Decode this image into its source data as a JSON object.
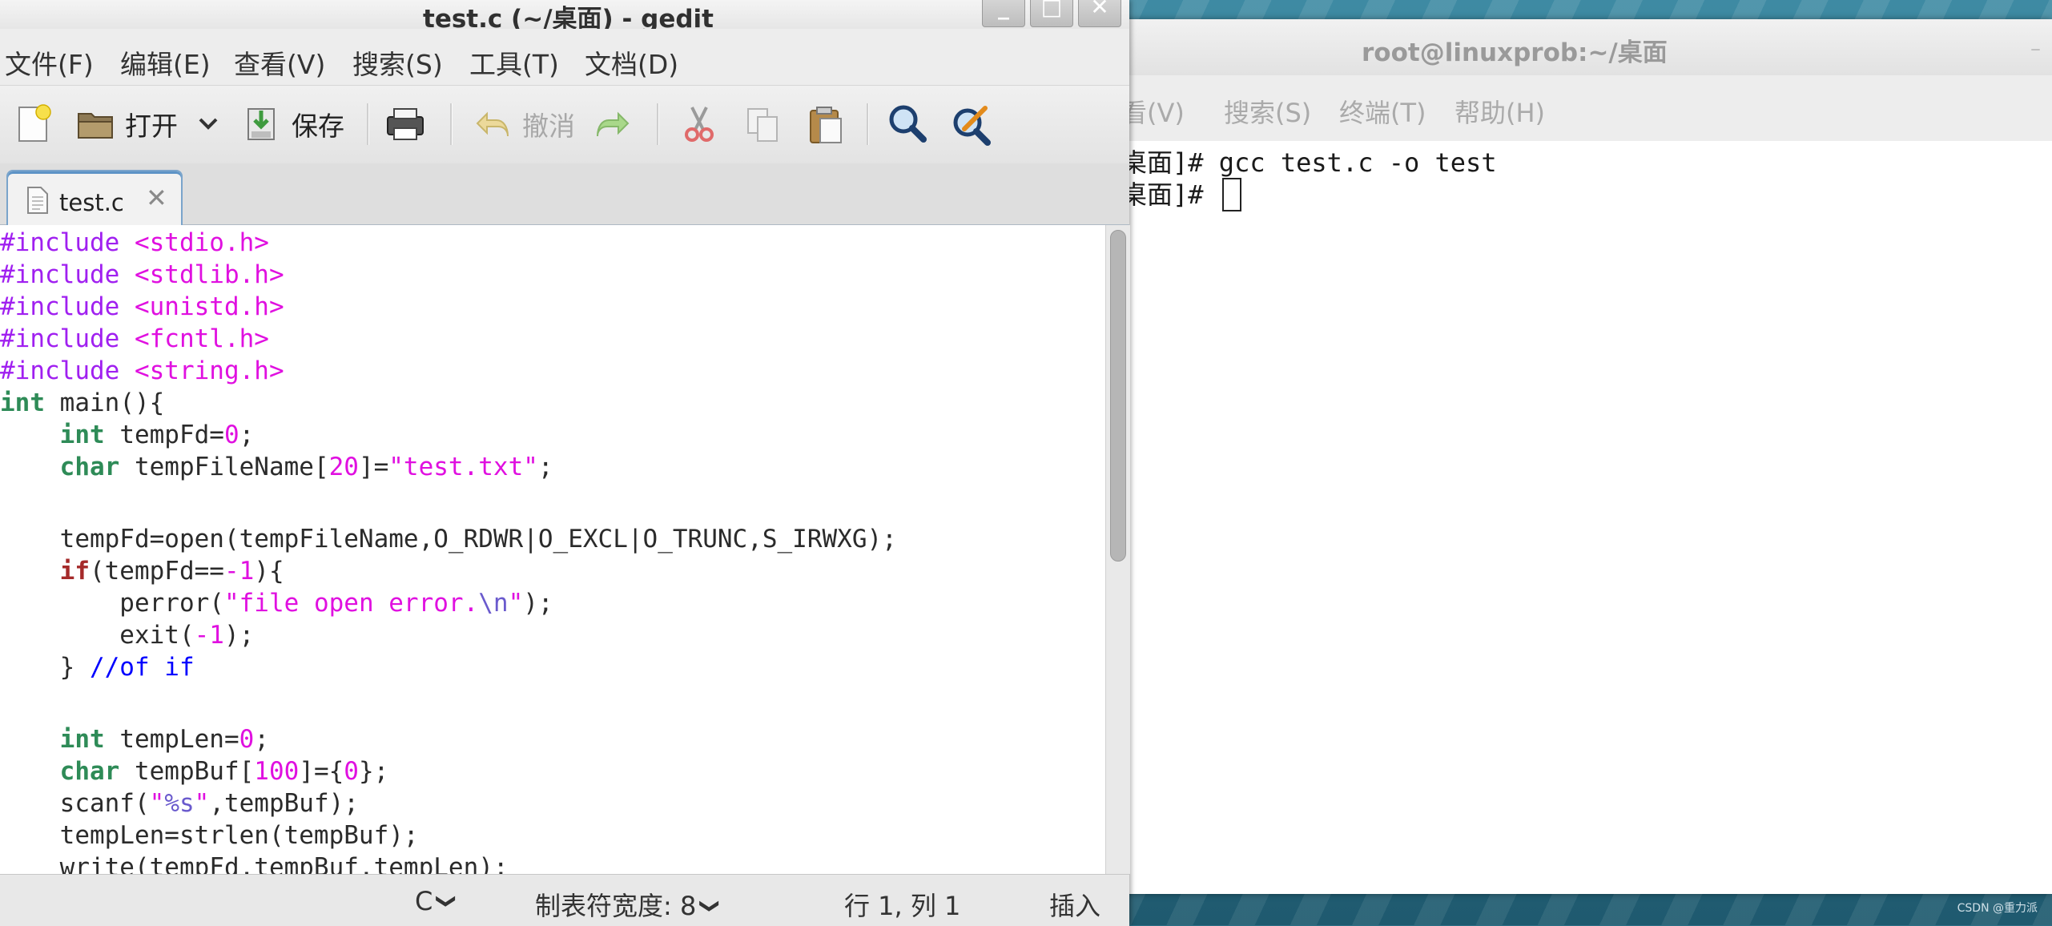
{
  "gedit": {
    "title": "test.c (~/桌面) - gedit",
    "window_buttons": {
      "minimize": "_",
      "maximize": "□",
      "close": "✕"
    },
    "menu": [
      "文件(F)",
      "编辑(E)",
      "查看(V)",
      "搜索(S)",
      "工具(T)",
      "文档(D)"
    ],
    "toolbar": {
      "open_label": "打开",
      "save_label": "保存",
      "undo_label": "撤消"
    },
    "tab": {
      "label": "test.c",
      "close": "✕"
    },
    "code": [
      "#include <stdio.h>",
      "#include <stdlib.h>",
      "#include <unistd.h>",
      "#include <fcntl.h>",
      "#include <string.h>",
      "int main(){",
      "    int tempFd=0;",
      "    char tempFileName[20]=\"test.txt\";",
      "",
      "    tempFd=open(tempFileName,O_RDWR|O_EXCL|O_TRUNC,S_IRWXG);",
      "    if(tempFd==-1){",
      "        perror(\"file open error.\\n\");",
      "        exit(-1);",
      "    } //of if",
      "",
      "    int tempLen=0;",
      "    char tempBuf[100]={0};",
      "    scanf(\"%s\",tempBuf);",
      "    tempLen=strlen(tempBuf);",
      "    write(tempFd,tempBuf,tempLen);"
    ],
    "status": {
      "language": "C",
      "tab_width": "制表符宽度: 8",
      "position": "行 1, 列 1",
      "mode": "插入"
    }
  },
  "terminal": {
    "title": "root@linuxprob:~/桌面",
    "minimize": "–",
    "menu": [
      "看(V)",
      "搜索(S)",
      "终端(T)",
      "帮助(H)"
    ],
    "lines": [
      "桌面]# gcc test.c -o test",
      "桌面]# "
    ]
  },
  "watermark": "CSDN @重力派",
  "icons": [
    "new-document-icon",
    "open-folder-icon",
    "chevron-down-icon",
    "save-icon",
    "print-icon",
    "undo-icon",
    "redo-icon",
    "cut-icon",
    "copy-icon",
    "paste-icon",
    "search-icon",
    "replace-icon",
    "document-icon",
    "close-icon"
  ]
}
